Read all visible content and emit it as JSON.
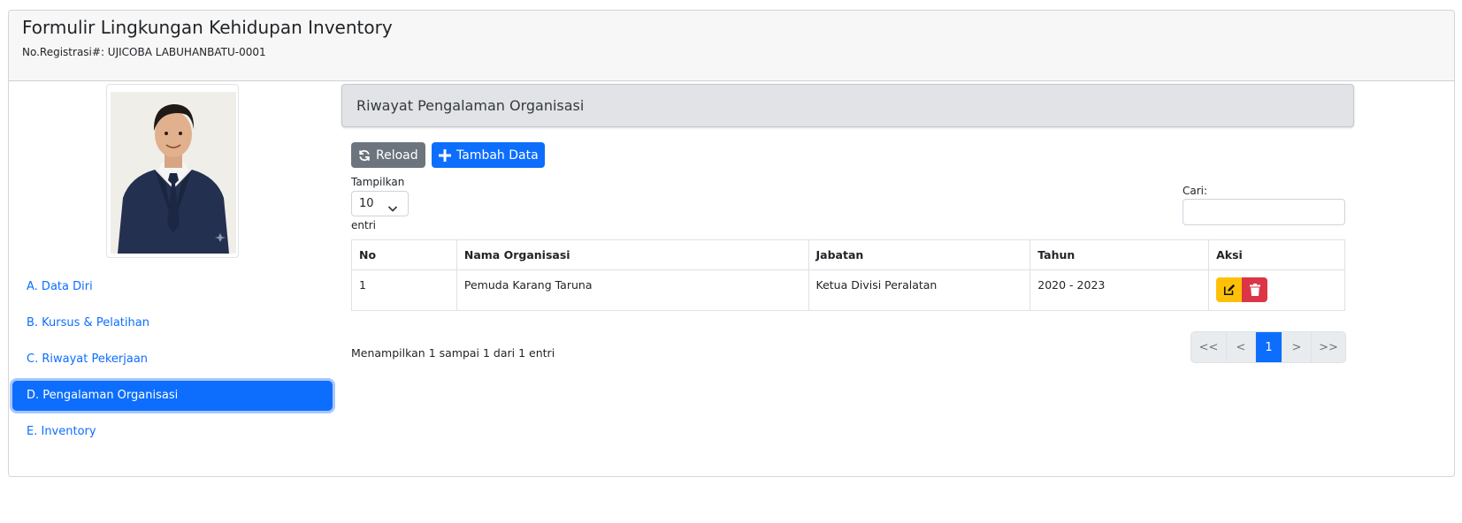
{
  "header": {
    "title": "Formulir Lingkungan Kehidupan Inventory",
    "reg": "No.Registrasi#: UJICOBA LABUHANBATU-0001"
  },
  "sidebar": {
    "items": [
      {
        "label": "A. Data Diri"
      },
      {
        "label": "B. Kursus & Pelatihan"
      },
      {
        "label": "C. Riwayat Pekerjaan"
      },
      {
        "label": "D. Pengalaman Organisasi",
        "active": true
      },
      {
        "label": "E. Inventory"
      }
    ]
  },
  "section": {
    "title": "Riwayat Pengalaman Organisasi"
  },
  "toolbar": {
    "reload_label": "Reload",
    "add_label": "Tambah Data"
  },
  "length": {
    "label": "Tampilkan",
    "value": "10",
    "suffix": "entri"
  },
  "search": {
    "label": "Cari:",
    "value": ""
  },
  "table": {
    "columns": [
      "No",
      "Nama Organisasi",
      "Jabatan",
      "Tahun",
      "Aksi"
    ],
    "rows": [
      [
        "1",
        "Pemuda Karang Taruna",
        "Ketua Divisi Peralatan",
        "2020 - 2023"
      ]
    ]
  },
  "info": "Menampilkan 1 sampai 1 dari 1 entri",
  "pagination": {
    "first": "<<",
    "prev": "<",
    "current": "1",
    "next": ">",
    "last": ">>"
  },
  "colors": {
    "primary": "#0d6efd",
    "secondary": "#6c757d",
    "warning": "#ffc107",
    "danger": "#dc3545"
  },
  "icons": {
    "reload": "sync-icon",
    "add": "plus-icon",
    "edit": "edit-icon",
    "delete": "trash-icon"
  }
}
